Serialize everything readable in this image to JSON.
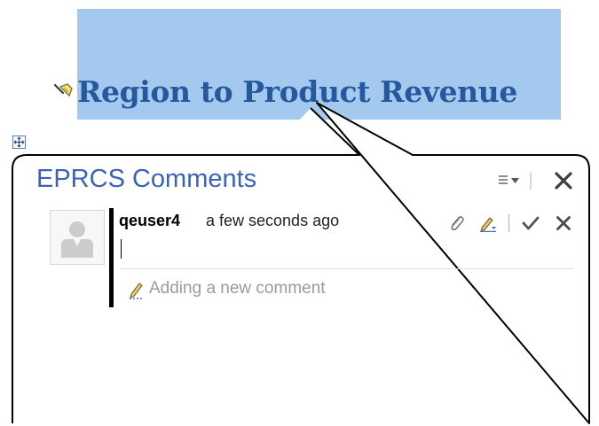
{
  "document": {
    "heading": "Region to Product Revenue"
  },
  "comments_panel": {
    "title": "EPRCS Comments",
    "comment": {
      "author": "qeuser4",
      "timestamp": "a few seconds ago",
      "body": ""
    },
    "add_comment_placeholder": "Adding a new comment"
  },
  "icons": {
    "pin": "pin-icon",
    "move": "move-handle-icon",
    "menu": "menu-dropdown-icon",
    "close": "close-icon",
    "avatar": "user-avatar-icon",
    "attach": "paperclip-icon",
    "edit": "edit-pencil-icon",
    "save": "checkmark-icon",
    "cancel": "close-icon",
    "add": "pencil-icon"
  },
  "colors": {
    "highlight": "#a3c9ee",
    "heading": "#27579d",
    "panel_title": "#3b63b7",
    "placeholder": "#9a9a9a",
    "thread_bar": "#000000"
  }
}
